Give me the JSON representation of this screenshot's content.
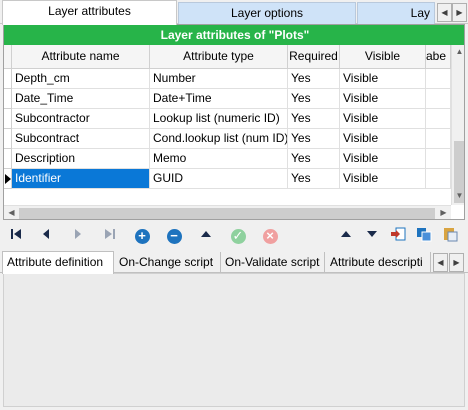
{
  "top_tabs": [
    {
      "label": "Layer attributes"
    },
    {
      "label": "Layer options"
    },
    {
      "label": "Lay"
    }
  ],
  "grid": {
    "caption": "Layer attributes of \"Plots\"",
    "columns": [
      "Attribute name",
      "Attribute type",
      "Required",
      "Visible",
      "abe"
    ],
    "rows": [
      {
        "name": "Depth_cm",
        "type": "Number",
        "required": "Yes",
        "visible": "Visible"
      },
      {
        "name": "Date_Time",
        "type": "Date+Time",
        "required": "Yes",
        "visible": "Visible"
      },
      {
        "name": "Subcontractor",
        "type": "Lookup list (numeric ID)",
        "required": "Yes",
        "visible": "Visible"
      },
      {
        "name": "Subcontract",
        "type": "Cond.lookup list (num ID)",
        "required": "Yes",
        "visible": "Visible"
      },
      {
        "name": "Description",
        "type": "Memo",
        "required": "Yes",
        "visible": "Visible"
      },
      {
        "name": "Identifier",
        "type": "GUID",
        "required": "Yes",
        "visible": "Visible"
      }
    ]
  },
  "colors": {
    "caption_bg": "#27b449",
    "selection_bg": "#0a78d7",
    "add": "#1e73be",
    "remove": "#1e73be",
    "post": "#8fd19e",
    "cancel": "#f0a0a0"
  },
  "navigator": {
    "first": "first-record-icon",
    "prior": "prior-record-icon",
    "next": "next-record-icon",
    "last": "last-record-icon",
    "insert": "add-icon",
    "delete": "remove-icon",
    "edit": "edit-icon",
    "post": "check-icon",
    "cancel": "cancel-icon"
  },
  "bottom_tabs": [
    {
      "label": "Attribute definition"
    },
    {
      "label": "On-Change script"
    },
    {
      "label": "On-Validate script"
    },
    {
      "label": "Attribute descripti"
    }
  ]
}
